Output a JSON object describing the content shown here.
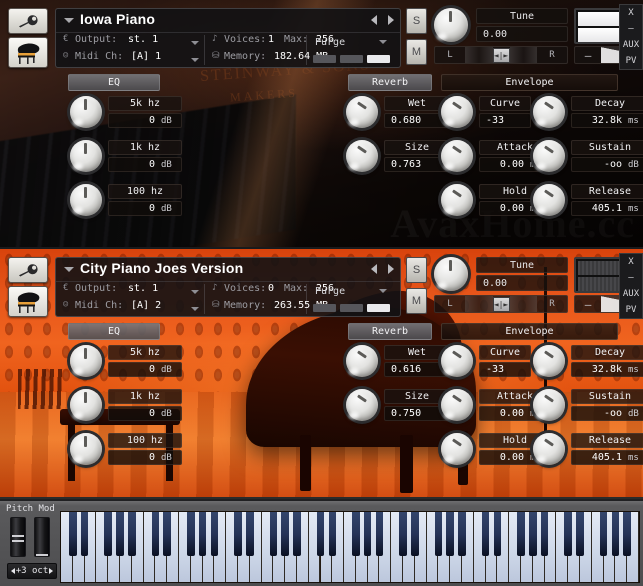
{
  "app": {
    "window_controls": [
      "X",
      "—",
      "AUX",
      "PV"
    ]
  },
  "instruments": [
    {
      "id": "iowa-piano",
      "title": "Iowa Piano",
      "solo_label": "S",
      "mute_label": "M",
      "purge_label": "Purge",
      "info": {
        "output_label": "Output:",
        "output_value": "st. 1",
        "midi_label": "Midi Ch:",
        "midi_value": "[A] 1",
        "voices_label": "Voices:",
        "voices_value": "1",
        "max_label": "Max:",
        "max_value": "256",
        "memory_label": "Memory:",
        "memory_value": "182.64 MB"
      },
      "tune": {
        "label": "Tune",
        "value": "0.00"
      },
      "pan": {
        "left": "L",
        "right": "R"
      },
      "volume": {
        "minus": "–",
        "plus": "+"
      },
      "eq": {
        "title": "EQ",
        "bands": [
          {
            "name": "5k hz",
            "value": "0",
            "unit": "dB"
          },
          {
            "name": "1k hz",
            "value": "0",
            "unit": "dB"
          },
          {
            "name": "100 hz",
            "value": "0",
            "unit": "dB"
          }
        ]
      },
      "reverb": {
        "title": "Reverb",
        "params": [
          {
            "name": "Wet",
            "value": "0.680",
            "unit": ""
          },
          {
            "name": "Size",
            "value": "0.763",
            "unit": ""
          }
        ]
      },
      "envelope": {
        "title": "Envelope",
        "col1": [
          {
            "name": "Curve",
            "value": "-33",
            "unit": ""
          },
          {
            "name": "Attack",
            "value": "0.00",
            "unit": "ms"
          },
          {
            "name": "Hold",
            "value": "0.00",
            "unit": "ms"
          }
        ],
        "col2": [
          {
            "name": "Decay",
            "value": "32.8k",
            "unit": "ms"
          },
          {
            "name": "Sustain",
            "value": "-oo",
            "unit": "dB"
          },
          {
            "name": "Release",
            "value": "405.1",
            "unit": "ms"
          }
        ]
      },
      "background_caption": "STEINWAY & SONS",
      "background_caption2": "MAKERS",
      "watermark": "AvaxHome.cc"
    },
    {
      "id": "city-piano-joes-version",
      "title": "City Piano Joes Version",
      "solo_label": "S",
      "mute_label": "M",
      "purge_label": "Purge",
      "info": {
        "output_label": "Output:",
        "output_value": "st. 1",
        "midi_label": "Midi Ch:",
        "midi_value": "[A] 2",
        "voices_label": "Voices:",
        "voices_value": "0",
        "max_label": "Max:",
        "max_value": "256",
        "memory_label": "Memory:",
        "memory_value": "263.55 MB"
      },
      "tune": {
        "label": "Tune",
        "value": "0.00"
      },
      "pan": {
        "left": "L",
        "right": "R"
      },
      "volume": {
        "minus": "–",
        "plus": "+"
      },
      "eq": {
        "title": "EQ",
        "bands": [
          {
            "name": "5k hz",
            "value": "0",
            "unit": "dB"
          },
          {
            "name": "1k hz",
            "value": "0",
            "unit": "dB"
          },
          {
            "name": "100 hz",
            "value": "0",
            "unit": "dB"
          }
        ]
      },
      "reverb": {
        "title": "Reverb",
        "params": [
          {
            "name": "Wet",
            "value": "0.616",
            "unit": ""
          },
          {
            "name": "Size",
            "value": "0.750",
            "unit": ""
          }
        ]
      },
      "envelope": {
        "title": "Envelope",
        "col1": [
          {
            "name": "Curve",
            "value": "-33",
            "unit": ""
          },
          {
            "name": "Attack",
            "value": "0.00",
            "unit": "ms"
          },
          {
            "name": "Hold",
            "value": "0.00",
            "unit": "ms"
          }
        ],
        "col2": [
          {
            "name": "Decay",
            "value": "32.8k",
            "unit": "ms"
          },
          {
            "name": "Sustain",
            "value": "-oo",
            "unit": "dB"
          },
          {
            "name": "Release",
            "value": "405.1",
            "unit": "ms"
          }
        ]
      }
    }
  ],
  "keyboard": {
    "pitch_label": "Pitch",
    "mod_label": "Mod",
    "octave_value": "+3 oct"
  }
}
